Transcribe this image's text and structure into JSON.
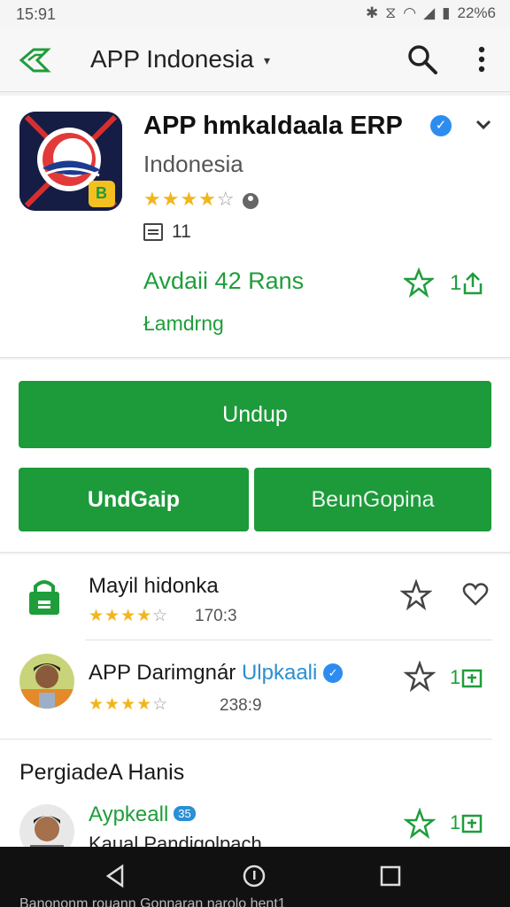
{
  "status": {
    "time": "15:91",
    "battery": "22%6",
    "icons": [
      "bluetooth-icon",
      "vibrate-icon",
      "wifi-icon",
      "signal-icon",
      "battery-icon"
    ]
  },
  "toolbar": {
    "title": "APP Indonesia",
    "caret": "▾"
  },
  "app": {
    "name": "APP hmkaldaala ERP",
    "developer": "Indonesia",
    "rating_stars": 3.5,
    "size_text": "11",
    "availability": "Avdaii 42 Rans",
    "share_count": "1",
    "status_text": "Łamdrng",
    "icon_badge": "B"
  },
  "actions": {
    "install_label": "Undup",
    "left_label": "UndGaip",
    "right_label": "BeunGopina"
  },
  "list": {
    "items": [
      {
        "title": "Mayil hidonka",
        "stars": 4.5,
        "count": "170:3"
      },
      {
        "title": "APP Darimgnár",
        "title_accent": "Ulpkaali",
        "stars": 4.5,
        "count": "238:9",
        "share_count": "1"
      }
    ],
    "section_title": "PergiadeA Hanis",
    "section_item": {
      "title": "Aypkeall",
      "badge": "35",
      "subtitle": "Kaual Pandiqolpach",
      "share_count": "1"
    }
  },
  "navbar": {
    "caption": "Banononm rouann Gonnaran narolo hent1"
  },
  "colors": {
    "brand_green": "#1d9a3a",
    "accent_blue": "#2d8cf0",
    "star_yellow": "#f1b61d"
  }
}
